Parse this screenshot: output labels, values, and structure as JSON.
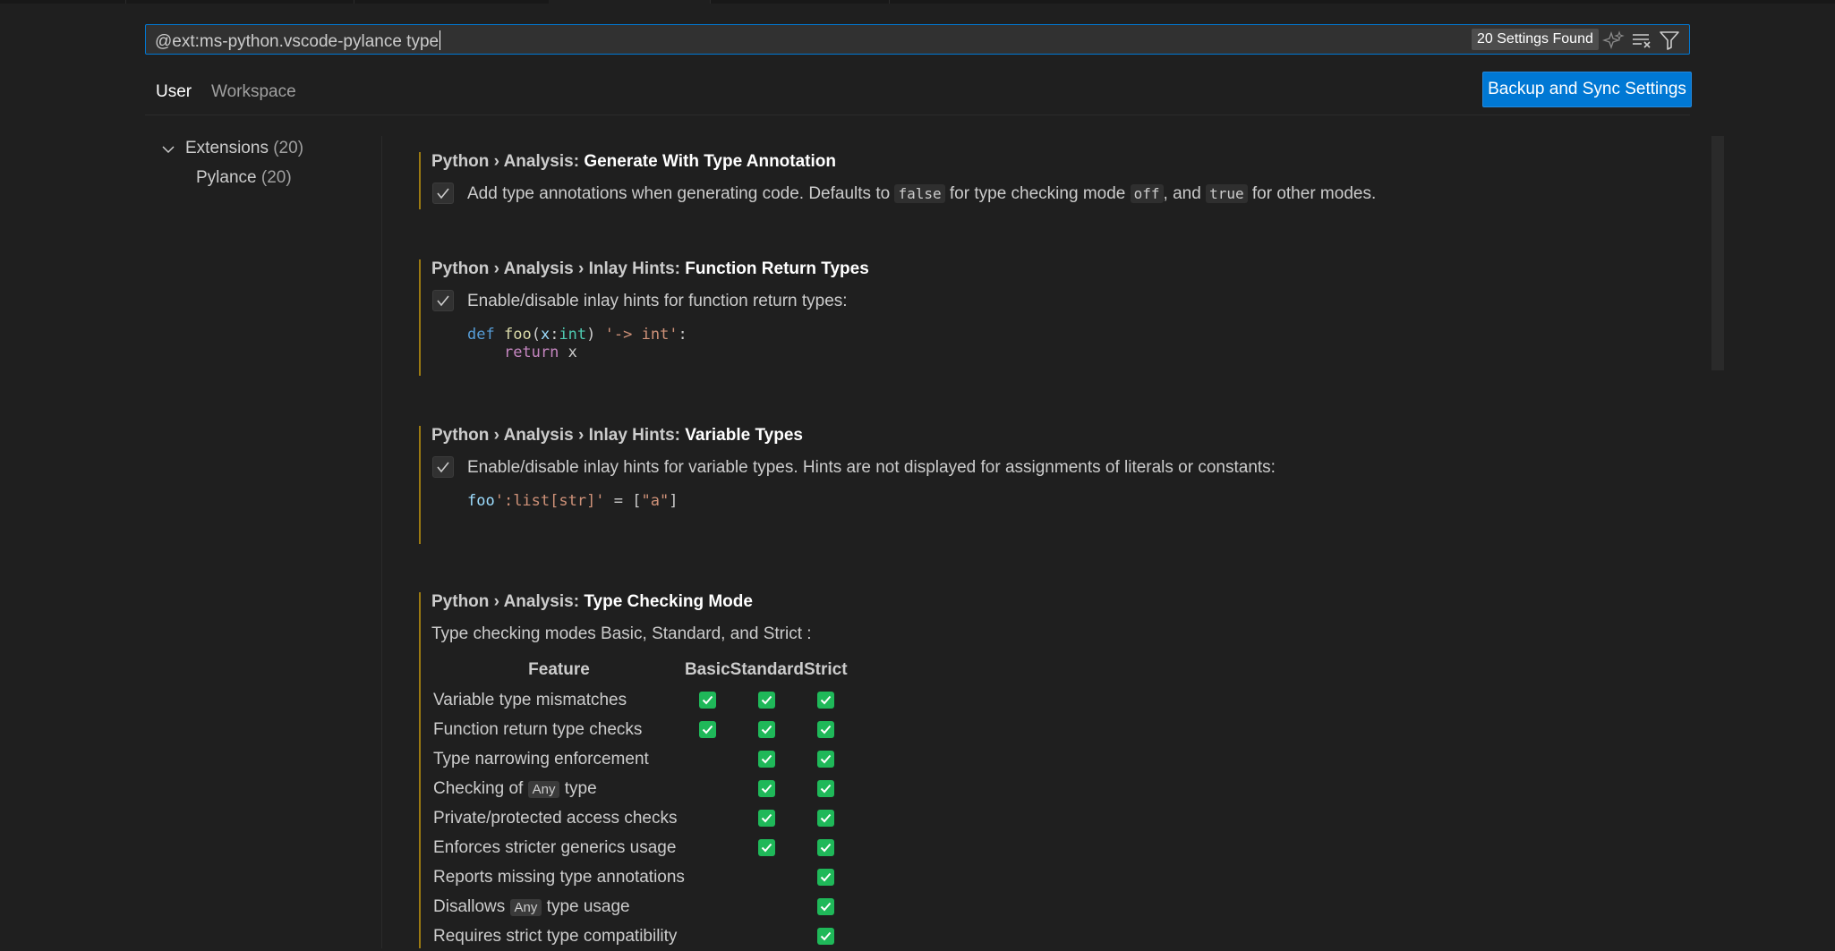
{
  "search": {
    "query": "@ext:ms-python.vscode-pylance type",
    "results_badge": "20 Settings Found"
  },
  "search_actions": [
    "sparkle-icon",
    "clear-filter-icon",
    "filter-icon"
  ],
  "tabs": [
    {
      "label": "User"
    },
    {
      "label": "Workspace"
    }
  ],
  "sync_button": "Backup and Sync Settings",
  "toc": {
    "extensions": {
      "label": "Extensions",
      "count": "(20)"
    },
    "pylance": {
      "label": "Pylance",
      "count": "(20)"
    }
  },
  "settings": [
    {
      "prefix": "Python › Analysis: ",
      "name": "Generate With Type Annotation",
      "checked": true,
      "desc": [
        "Add type annotations when generating code. Defaults to ",
        "false",
        " for type checking mode ",
        "off",
        ", and ",
        "true",
        " for other modes."
      ]
    },
    {
      "prefix": "Python › Analysis › Inlay Hints: ",
      "name": "Function Return Types",
      "checked": true,
      "desc": "Enable/disable inlay hints for function return types:",
      "code": {
        "kw_def": "def",
        "fn": "foo",
        "open": "(",
        "param": "x",
        "colon": ":",
        "type": "int",
        "close": ")",
        "hint": "'-> int'",
        "end": ":",
        "kw_return": "return",
        "ret": " x"
      }
    },
    {
      "prefix": "Python › Analysis › Inlay Hints: ",
      "name": "Variable Types",
      "checked": true,
      "desc": "Enable/disable inlay hints for variable types. Hints are not displayed for assignments of literals or constants:",
      "code": {
        "var": "foo",
        "hint": "':list[str]'",
        "assign": " = [",
        "str": "\"a\"",
        "end": "]"
      }
    },
    {
      "prefix": "Python › Analysis: ",
      "name": "Type Checking Mode",
      "desc": "Type checking modes Basic, Standard, and Strict :",
      "table": {
        "headers": [
          "Feature",
          "Basic",
          "Standard",
          "Strict"
        ],
        "rows": [
          {
            "feature": "Variable type mismatches",
            "basic": true,
            "standard": true,
            "strict": true
          },
          {
            "feature": "Function return type checks",
            "basic": true,
            "standard": true,
            "strict": true
          },
          {
            "feature": "Type narrowing enforcement",
            "basic": false,
            "standard": true,
            "strict": true
          },
          {
            "feature_pre": "Checking of ",
            "feature_code": "Any",
            "feature_post": " type",
            "basic": false,
            "standard": true,
            "strict": true
          },
          {
            "feature": "Private/protected access checks",
            "basic": false,
            "standard": true,
            "strict": true
          },
          {
            "feature": "Enforces stricter generics usage",
            "basic": false,
            "standard": true,
            "strict": true
          },
          {
            "feature": "Reports missing type annotations",
            "basic": false,
            "standard": false,
            "strict": true
          },
          {
            "feature_pre": "Disallows ",
            "feature_code": "Any",
            "feature_post": " type usage",
            "basic": false,
            "standard": false,
            "strict": true
          },
          {
            "feature": "Requires strict type compatibility",
            "basic": false,
            "standard": false,
            "strict": true
          }
        ]
      }
    }
  ],
  "colors": {
    "accent": "#0078d4",
    "modified_bar": "#9c7a12",
    "check_green": "#1fb859",
    "background": "#1f1f1f"
  }
}
